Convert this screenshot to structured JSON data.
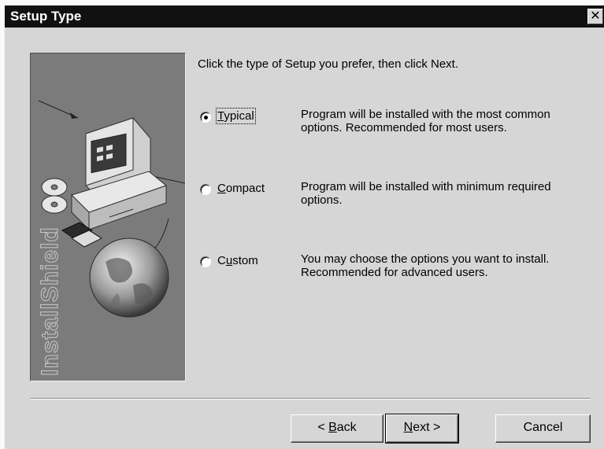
{
  "window": {
    "title": "Setup Type",
    "close_glyph": "✕"
  },
  "banner": {
    "brand_text": "InstallShield"
  },
  "prompt": "Click the type of Setup you prefer, then click Next.",
  "options": [
    {
      "id": "typical",
      "label_pre": "",
      "label_mnemonic": "T",
      "label_post": "ypical",
      "selected": true,
      "description_line1": "Program will be installed with the most common",
      "description_line2": "options.  Recommended for most users."
    },
    {
      "id": "compact",
      "label_pre": "",
      "label_mnemonic": "C",
      "label_post": "ompact",
      "selected": false,
      "description_line1": "Program will be installed with minimum required",
      "description_line2": "options."
    },
    {
      "id": "custom",
      "label_pre": "C",
      "label_mnemonic": "u",
      "label_post": "stom",
      "selected": false,
      "description_line1": "You may choose the options you want to install.",
      "description_line2": "Recommended for advanced users."
    }
  ],
  "buttons": {
    "back_prefix": "< ",
    "back_mnemonic": "B",
    "back_rest": "ack",
    "next_mnemonic": "N",
    "next_rest": "ext",
    "next_suffix": " >",
    "cancel": "Cancel"
  },
  "colors": {
    "dialog_bg": "#d6d6d6",
    "titlebar_bg": "#111111",
    "banner_bg": "#7b7b7b"
  }
}
